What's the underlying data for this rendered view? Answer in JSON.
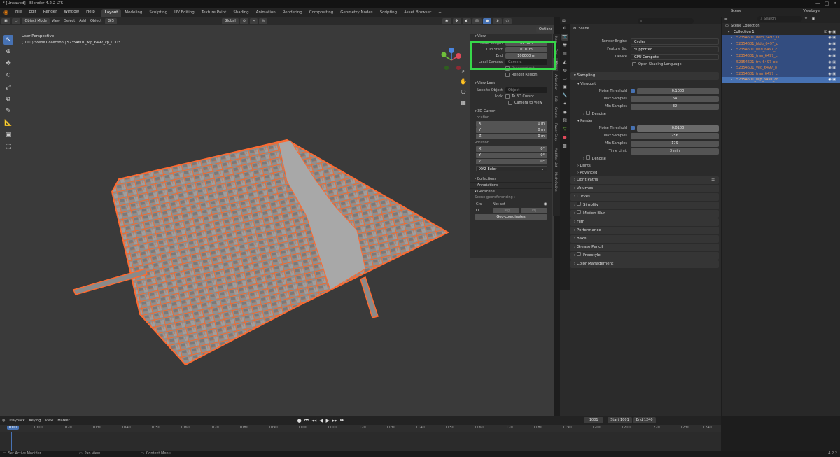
{
  "window": {
    "title": "* [Unsaved] - Blender 4.2.2 LTS"
  },
  "menu": {
    "items": [
      "File",
      "Edit",
      "Render",
      "Window",
      "Help"
    ],
    "workspaces": [
      "Layout",
      "Modeling",
      "Sculpting",
      "UV Editing",
      "Texture Paint",
      "Shading",
      "Animation",
      "Rendering",
      "Compositing",
      "Geometry Nodes",
      "Scripting",
      "Asset Browser"
    ],
    "active_workspace": "Layout",
    "add_tab": "+"
  },
  "topright": {
    "scene_label": "Scene",
    "viewlayer_label": "ViewLayer"
  },
  "viewport_header": {
    "mode": "Object Mode",
    "menus": [
      "View",
      "Select",
      "Add",
      "Object"
    ],
    "gizmo_label": "GIS",
    "orientation": "Global",
    "options": "Options"
  },
  "viewport": {
    "perspective": "User Perspective",
    "collection_info": "(1001) Scene Collection | 52354601_wip_6497_cp_LOD3"
  },
  "npanel": {
    "view_title": "View",
    "focal_length_label": "Focal Length",
    "focal_length_value": "50 mm",
    "clip_start_label": "Clip Start",
    "clip_start_value": "0.01 m",
    "end_label": "End",
    "end_value": "100000 m",
    "local_camera_label": "Local Camera",
    "local_camera_value": "Camera",
    "passepartout_label": "Passepartout",
    "render_region_label": "Render Region",
    "view_lock_title": "View Lock",
    "lock_to_object_label": "Lock to Object",
    "lock_to_object_placeholder": "Object",
    "lock_label": "Lock",
    "to_3d_cursor_label": "To 3D Cursor",
    "camera_to_view_label": "Camera to View",
    "cursor_title": "3D Cursor",
    "location_label": "Location",
    "rotation_label": "Rotation",
    "location": [
      {
        "axis": "X",
        "value": "0 m"
      },
      {
        "axis": "Y",
        "value": "0 m"
      },
      {
        "axis": "Z",
        "value": "0 m"
      }
    ],
    "rotation": [
      {
        "axis": "X",
        "value": "0°"
      },
      {
        "axis": "Y",
        "value": "0°"
      },
      {
        "axis": "Z",
        "value": "0°"
      }
    ],
    "rotation_mode": "XYZ Euler",
    "collections_title": "Collections",
    "annotations_title": "Annotations",
    "geoscene_title": "Geoscene",
    "georef_label": "Scene georeferencing :",
    "crs_label": "Crs",
    "crs_value": "Not set",
    "origin_label": "O...",
    "deg_label": "Deg",
    "prj_label": "Prj",
    "geo_button": "Geo-coordinates"
  },
  "vtabs": [
    "Item",
    "Tool",
    "View",
    "Animation",
    "Edit",
    "Create",
    "Power Sequ",
    "Modifier List",
    "Mesh Online"
  ],
  "properties": {
    "scene_label": "Scene",
    "render_engine_label": "Render Engine",
    "render_engine_value": "Cycles",
    "feature_set_label": "Feature Set",
    "feature_set_value": "Supported",
    "device_label": "Device",
    "device_value": "GPU Compute",
    "osl_label": "Open Shading Language",
    "sampling_title": "Sampling",
    "viewport_title": "Viewport",
    "render_title": "Render",
    "noise_threshold_label": "Noise Threshold",
    "viewport_noise_value": "0.1000",
    "max_samples_label": "Max Samples",
    "viewport_max_samples": "64",
    "min_samples_label": "Min Samples",
    "viewport_min_samples": "32",
    "denoise_label": "Denoise",
    "render_noise_value": "0.0100",
    "render_max_samples": "256",
    "render_min_samples": "179",
    "time_limit_label": "Time Limit",
    "time_limit_value": "3 min",
    "lights_label": "Lights",
    "advanced_label": "Advanced",
    "panels": [
      "Light Paths",
      "Volumes",
      "Curves",
      "Simplify",
      "Motion Blur",
      "Film",
      "Performance",
      "Bake",
      "Grease Pencil",
      "Freestyle",
      "Color Management"
    ]
  },
  "outliner": {
    "search_placeholder": "Search",
    "root": "Scene Collection",
    "collection": "Collection 1",
    "objects": [
      "52354601_dem_6497_00...",
      "52354601_bldg_6497_c",
      "52354601_brid_6497_c",
      "52354601_tran_6497_c",
      "52354601_frn_6497_op",
      "52354601_veg_6497_o",
      "52354601_tran_6497_c",
      "52354601_wip_6497_cr"
    ]
  },
  "timeline": {
    "menus": [
      "Playback",
      "Keying",
      "View",
      "Marker"
    ],
    "current_frame": "1001",
    "start_label": "Start",
    "start_value": "1001",
    "end_label": "End",
    "end_value": "1240",
    "ticks": [
      "1001",
      "1010",
      "1020",
      "1030",
      "1040",
      "1050",
      "1060",
      "1070",
      "1080",
      "1090",
      "1100",
      "1110",
      "1120",
      "1130",
      "1140",
      "1150",
      "1160",
      "1170",
      "1180",
      "1190",
      "1200",
      "1210",
      "1220",
      "1230",
      "1240"
    ]
  },
  "status": {
    "left": "Set Active Modifier",
    "middle": "Pan View",
    "right": "Context Menu",
    "version": "4.2.2"
  },
  "colors": {
    "accent": "#4772b3",
    "selection_outline": "#ff6a30",
    "highlight_box": "#37d84a"
  }
}
